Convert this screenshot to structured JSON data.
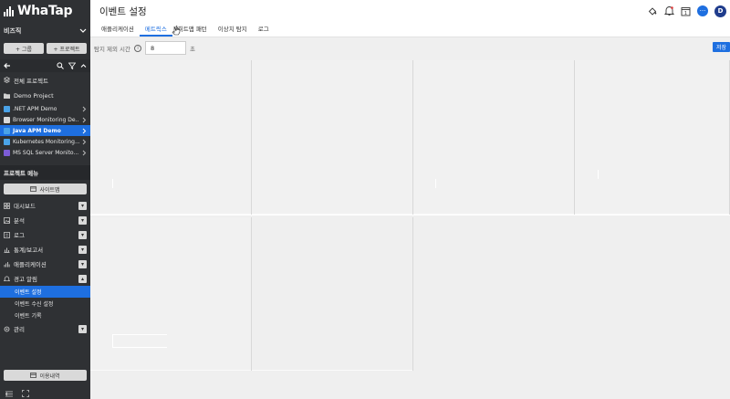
{
  "app": {
    "logo": "WhaTap"
  },
  "sidebar": {
    "business": "비즈직",
    "add_group": "+ 그룹",
    "add_project": "+ 프로젝트",
    "all_projects": "전체 프로젝트",
    "demo_project": "Demo Project",
    "projects": [
      {
        "label": ".NET APM Demo",
        "color": "#4aa3e8",
        "active": false
      },
      {
        "label": "Browser Monitoring De...",
        "color": "#d9d9d9",
        "active": false
      },
      {
        "label": "Java APM Demo",
        "color": "#4aa3e8",
        "active": true
      },
      {
        "label": "Kubernetes Monitoring...",
        "color": "#4aa3e8",
        "active": false
      },
      {
        "label": "MS SQL Server Monito...",
        "color": "#7c5cd6",
        "active": false
      }
    ],
    "menu_header": "프로젝트 메뉴",
    "sitemap": "사이트맵",
    "menu": [
      {
        "label": "대시보드",
        "icon": "dashboard-icon"
      },
      {
        "label": "분석",
        "icon": "image-icon"
      },
      {
        "label": "로그",
        "icon": "log-icon"
      },
      {
        "label": "통계/보고서",
        "icon": "chart-icon"
      },
      {
        "label": "애플리케이션",
        "icon": "app-icon"
      },
      {
        "label": "경고 알림",
        "icon": "bell-icon"
      }
    ],
    "alert_sub": [
      "이벤트 설정",
      "이벤트 수신 설정",
      "이벤트 기록"
    ],
    "manage": "관리",
    "usage": "이용내역"
  },
  "header": {
    "title": "이벤트 설정",
    "avatar": "D",
    "chat": "···"
  },
  "tabs": [
    {
      "label": "애플리케이션",
      "active": false
    },
    {
      "label": "메트릭스",
      "active": true
    },
    {
      "label": "히트맵 패턴",
      "active": false
    },
    {
      "label": "이상치 탐지",
      "active": false
    },
    {
      "label": "로그",
      "active": false
    }
  ],
  "settings": {
    "detect_label": "탐지 제외 시간",
    "value": "8",
    "unit": "초",
    "save": "저장"
  },
  "colors": {
    "accent": "#1e6fe0",
    "sidebar_bg": "#2f3134"
  }
}
